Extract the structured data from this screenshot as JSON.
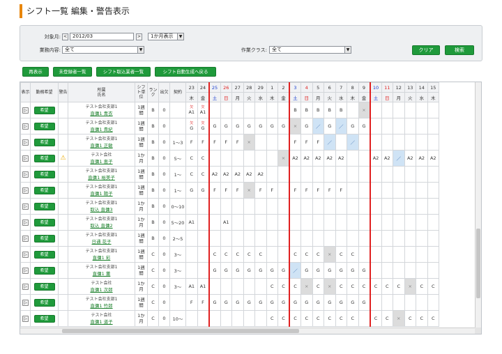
{
  "page": {
    "title": "シフト一覧 編集・警告表示"
  },
  "filter": {
    "month_label": "対象月:",
    "month_value": "2012/03",
    "month_prev": "<",
    "month_next": ">",
    "display_range": "1か月表示",
    "work_label": "業務内容:",
    "work_value": "全て",
    "class_label": "作業クラス:",
    "class_value": "全て",
    "clear_button": "クリア",
    "search_button": "検索"
  },
  "toolbar": {
    "buttons": [
      "再表示",
      "未登録者一覧",
      "シフト取込業者一覧",
      "シフト自動生成へ戻る"
    ]
  },
  "grid": {
    "headers": {
      "expand": "表示",
      "wish": "勤務希望",
      "alert": "警告",
      "dept_name": "所属\n氏名",
      "unit": "シフト単位",
      "rank": "ランク",
      "absence": "出欠",
      "contract": "契約"
    },
    "days": [
      {
        "d": "23",
        "w": "木"
      },
      {
        "d": "24",
        "w": "金"
      },
      {
        "d": "25",
        "w": "土"
      },
      {
        "d": "26",
        "w": "日"
      },
      {
        "d": "27",
        "w": "月"
      },
      {
        "d": "28",
        "w": "火"
      },
      {
        "d": "29",
        "w": "水"
      },
      {
        "d": "1",
        "w": "木"
      },
      {
        "d": "2",
        "w": "金"
      },
      {
        "d": "3",
        "w": "土"
      },
      {
        "d": "4",
        "w": "日"
      },
      {
        "d": "5",
        "w": "月"
      },
      {
        "d": "6",
        "w": "火"
      },
      {
        "d": "7",
        "w": "水"
      },
      {
        "d": "8",
        "w": "木"
      },
      {
        "d": "9",
        "w": "金"
      },
      {
        "d": "10",
        "w": "土"
      },
      {
        "d": "11",
        "w": "日"
      },
      {
        "d": "12",
        "w": "月"
      },
      {
        "d": "13",
        "w": "火"
      },
      {
        "d": "14",
        "w": "水"
      },
      {
        "d": "15",
        "w": "木"
      }
    ],
    "wish_label": "希望",
    "rows": [
      {
        "dept": "テスト会社支部1",
        "name": "直傭1 青衣",
        "unit": "1週間",
        "rank": "B",
        "abs": "0",
        "contract": "",
        "warn": false,
        "cells": [
          "欠|A1",
          "欠|A1",
          "",
          "",
          "",
          "",
          "",
          "",
          "",
          "B",
          "B",
          "B",
          "B",
          "B",
          "",
          "×",
          "",
          "",
          "",
          "",
          "",
          ""
        ]
      },
      {
        "dept": "テスト会社支部1",
        "name": "直傭1 貴紀",
        "unit": "1週間",
        "rank": "B",
        "abs": "0",
        "contract": "",
        "warn": false,
        "cells": [
          "欠|G",
          "欠|G",
          "G",
          "G",
          "G",
          "G",
          "G",
          "G",
          "G",
          "×",
          "G",
          "／",
          "G",
          "／",
          "G",
          "G",
          "",
          "",
          "",
          "",
          "",
          ""
        ]
      },
      {
        "dept": "テスト会社支部1",
        "name": "直傭1 正敏",
        "unit": "1週間",
        "rank": "B",
        "abs": "0",
        "contract": "1〜3",
        "warn": false,
        "cells": [
          "F",
          "F",
          "F",
          "F",
          "F",
          "×",
          "",
          "",
          "",
          "F",
          "F",
          "F",
          "／",
          "",
          "／",
          "",
          "",
          "",
          "",
          "",
          "",
          ""
        ]
      },
      {
        "dept": "テスト会社",
        "name": "直傭1 恵子",
        "unit": "1か月",
        "rank": "B",
        "abs": "0",
        "contract": "5〜",
        "warn": true,
        "cells": [
          "C",
          "C",
          "",
          "",
          "",
          "",
          "",
          "",
          "×",
          "A2",
          "A2",
          "A2",
          "A2",
          "A2",
          "",
          "",
          "A2",
          "A2",
          "／",
          "A2",
          "A2",
          "A2"
        ]
      },
      {
        "dept": "テスト会社支部1",
        "name": "直傭1 裕美子",
        "unit": "1週間",
        "rank": "B",
        "abs": "0",
        "contract": "1〜",
        "warn": false,
        "cells": [
          "C",
          "C",
          "A2",
          "A2",
          "A2",
          "A2",
          "A2",
          "",
          "",
          "",
          "",
          "",
          "",
          "",
          "",
          "",
          "",
          "",
          "",
          "",
          "",
          ""
        ]
      },
      {
        "dept": "テスト会社支部1",
        "name": "直傭1 陽子",
        "unit": "1週間",
        "rank": "B",
        "abs": "0",
        "contract": "1〜",
        "warn": false,
        "cells": [
          "G",
          "G",
          "F",
          "F",
          "F",
          "×",
          "F",
          "F",
          "",
          "F",
          "F",
          "F",
          "F",
          "F",
          "",
          "",
          "",
          "",
          "",
          "",
          "",
          ""
        ]
      },
      {
        "dept": "テスト会社支部1",
        "name": "取込 直傭3",
        "unit": "1か月",
        "rank": "B",
        "abs": "0",
        "contract": "0〜10",
        "warn": false,
        "cells": [
          "",
          "",
          "",
          "",
          "",
          "",
          "",
          "",
          "",
          "",
          "",
          "",
          "",
          "",
          "",
          "",
          "",
          "",
          "",
          "",
          "",
          ""
        ]
      },
      {
        "dept": "テスト会社支部1",
        "name": "取込 直傭2",
        "unit": "1か月",
        "rank": "B",
        "abs": "0",
        "contract": "5〜20",
        "warn": false,
        "cells": [
          "A1",
          "",
          "",
          "A1",
          "",
          "",
          "",
          "",
          "",
          "",
          "",
          "",
          "",
          "",
          "",
          "",
          "",
          "",
          "",
          "",
          "",
          ""
        ]
      },
      {
        "dept": "テスト会社支部1",
        "name": "日通 花子",
        "unit": "1週間",
        "rank": "B",
        "abs": "0",
        "contract": "2〜5",
        "warn": false,
        "cells": [
          "",
          "",
          "",
          "",
          "",
          "",
          "",
          "",
          "",
          "",
          "",
          "",
          "",
          "",
          "",
          "",
          "",
          "",
          "",
          "",
          "",
          ""
        ]
      },
      {
        "dept": "テスト会社支部1",
        "name": "直傭1 彩",
        "unit": "1週間",
        "rank": "C",
        "abs": "0",
        "contract": "3〜",
        "warn": false,
        "cells": [
          "",
          "",
          "C",
          "C",
          "C",
          "C",
          "C",
          "",
          "",
          "C",
          "C",
          "C",
          "×",
          "C",
          "C",
          "",
          "",
          "",
          "",
          "",
          "",
          ""
        ]
      },
      {
        "dept": "テスト会社支部1",
        "name": "直傭1 薫",
        "unit": "1週間",
        "rank": "C",
        "abs": "0",
        "contract": "3〜",
        "warn": false,
        "cells": [
          "",
          "",
          "G",
          "G",
          "G",
          "G",
          "G",
          "G",
          "G",
          "／",
          "G",
          "G",
          "G",
          "G",
          "G",
          "G",
          "",
          "",
          "",
          "",
          "",
          ""
        ]
      },
      {
        "dept": "テスト会社",
        "name": "直傭1 次郎",
        "unit": "1か月",
        "rank": "C",
        "abs": "0",
        "contract": "3〜",
        "warn": false,
        "cells": [
          "A1",
          "A1",
          "",
          "",
          "",
          "",
          "",
          "C",
          "C",
          "C",
          "×",
          "C",
          "×",
          "C",
          "C",
          "C",
          "C",
          "C",
          "C",
          "×",
          "C",
          "C"
        ]
      },
      {
        "dept": "テスト会社支部1",
        "name": "直傭1 竹郎",
        "unit": "1週間",
        "rank": "C",
        "abs": "0",
        "contract": "",
        "warn": false,
        "cells": [
          "F",
          "F",
          "G",
          "G",
          "G",
          "G",
          "G",
          "G",
          "G",
          "G",
          "G",
          "G",
          "G",
          "G",
          "G",
          "G",
          "",
          "",
          "",
          "",
          "",
          ""
        ]
      },
      {
        "dept": "テスト会社",
        "name": "直傭1 道子",
        "unit": "1か月",
        "rank": "C",
        "abs": "0",
        "contract": "10〜",
        "warn": false,
        "cells": [
          "",
          "",
          "",
          "",
          "",
          "",
          "",
          "C",
          "C",
          "C",
          "C",
          "C",
          "C",
          "C",
          "C",
          "",
          "C",
          "C",
          "×",
          "C",
          "C",
          "C"
        ]
      }
    ]
  }
}
